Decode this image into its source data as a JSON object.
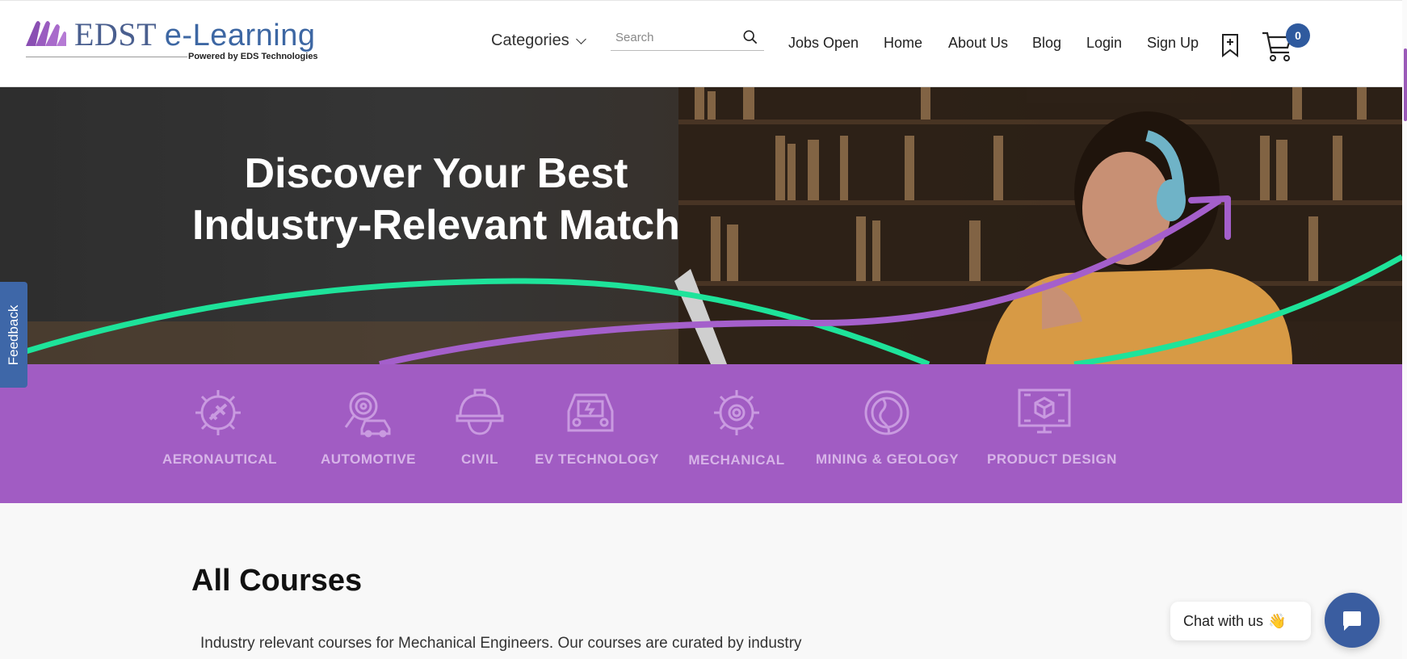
{
  "header": {
    "logo": {
      "brand": "EDST",
      "product": "e-Learning",
      "powered_by": "Powered by EDS Technologies"
    },
    "categories_label": "Categories",
    "search": {
      "placeholder": "Search",
      "value": ""
    },
    "nav": [
      "Jobs Open",
      "Home",
      "About Us",
      "Blog",
      "Login",
      "Sign Up"
    ],
    "cart_count": "0"
  },
  "hero": {
    "title_line1": "Discover Your Best",
    "title_line2": "Industry-Relevant Match"
  },
  "categories": [
    {
      "label": "AERONAUTICAL",
      "icon": "aeronautical-gear-icon"
    },
    {
      "label": "AUTOMOTIVE",
      "icon": "automotive-icon"
    },
    {
      "label": "CIVIL",
      "icon": "civil-helmet-icon"
    },
    {
      "label": "EV TECHNOLOGY",
      "icon": "ev-car-icon"
    },
    {
      "label": "MECHANICAL",
      "icon": "mechanical-gear-icon"
    },
    {
      "label": "MINING & GEOLOGY",
      "icon": "globe-icon"
    },
    {
      "label": "PRODUCT DESIGN",
      "icon": "product-design-icon"
    }
  ],
  "feedback_label": "Feedback",
  "content": {
    "title": "All Courses",
    "description": "Industry relevant courses for Mechanical Engineers. Our courses are curated by industry"
  },
  "chat": {
    "label": "Chat with us",
    "emoji": "👋"
  },
  "colors": {
    "brand_purple": "#a15cc3",
    "brand_blue": "#3e67a8",
    "green_curve": "#1ee39a"
  }
}
